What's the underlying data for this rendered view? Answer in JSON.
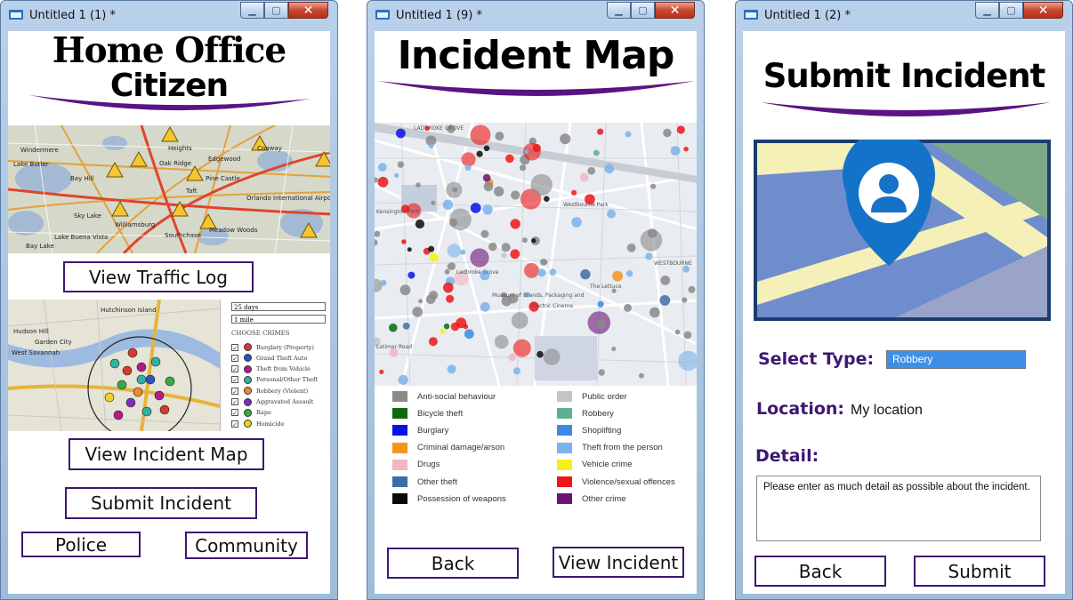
{
  "windows": [
    {
      "title": "Untitled 1 (1) *"
    },
    {
      "title": "Untitled 1 (9) *"
    },
    {
      "title": "Untitled 1 (2) *"
    }
  ],
  "home": {
    "title_line1": "Home Office",
    "title_line2": "Citizen",
    "view_traffic_log": "View Traffic Log",
    "view_incident_map": "View Incident Map",
    "submit_incident": "Submit Incident",
    "police": "Police",
    "community": "Community",
    "traffic_map_labels": [
      "Windermere",
      "Lake Butler",
      "Bay Hill",
      "Sky Lake",
      "Lake Buena Vista",
      "Heights",
      "Edgewood",
      "Pine Castle",
      "Oak Ridge",
      "Taft",
      "Williamsburg",
      "Southchase",
      "Meadow Woods",
      "Bay Lake",
      "Conway",
      "Orlando International Airport"
    ],
    "crime_panel": {
      "period_select": "25 days",
      "distance_select": "1 mile",
      "heading": "CHOOSE CRIMES",
      "items": [
        {
          "label": "Burglary (Property)",
          "color": "#d63a2f"
        },
        {
          "label": "Grand Theft Auto",
          "color": "#2d53c0"
        },
        {
          "label": "Theft from Vehicle",
          "color": "#b31a8c"
        },
        {
          "label": "Personal/Other Theft",
          "color": "#2fb3a3"
        },
        {
          "label": "Robbery (Violent)",
          "color": "#f08a2a"
        },
        {
          "label": "Aggravated Assault",
          "color": "#7d2cc0"
        },
        {
          "label": "Rape",
          "color": "#3aa84a"
        },
        {
          "label": "Homicide",
          "color": "#f2d21f"
        }
      ],
      "map_labels": [
        "Hutchinson Island",
        "Hudson Hill",
        "Garden City",
        "West Savannah"
      ]
    }
  },
  "incident_map": {
    "title": "Incident Map",
    "map_labels": [
      "LADBROKE GROVE",
      "Kensington Park",
      "Westbourne Park",
      "Ladbroke Grove",
      "Museum of Brands, Packaging and",
      "The Lettuce",
      "Electric Cinema",
      "WESTBOURNE",
      "Latimer Road"
    ],
    "legend": [
      {
        "label": "Anti-social behaviour",
        "color": "#8a8a8a"
      },
      {
        "label": "Bicycle theft",
        "color": "#0c6a0c"
      },
      {
        "label": "Burglary",
        "color": "#0a12e6"
      },
      {
        "label": "Criminal damage/arson",
        "color": "#f5951f"
      },
      {
        "label": "Drugs",
        "color": "#f4b6c2"
      },
      {
        "label": "Other theft",
        "color": "#3b6ea8"
      },
      {
        "label": "Possession of weapons",
        "color": "#0a0a0a"
      },
      {
        "label": "Public order",
        "color": "#c4c4c4"
      },
      {
        "label": "Robbery",
        "color": "#5bb28f"
      },
      {
        "label": "Shoplifting",
        "color": "#3a8ae4"
      },
      {
        "label": "Theft from the person",
        "color": "#7ab3ea"
      },
      {
        "label": "Vehicle crime",
        "color": "#f5f01a"
      },
      {
        "label": "Violence/sexual offences",
        "color": "#f01616"
      },
      {
        "label": "Other crime",
        "color": "#6b1476"
      }
    ],
    "back": "Back",
    "view_incident": "View Incident"
  },
  "submit": {
    "title": "Submit Incident",
    "select_type_label": "Select Type:",
    "select_type_value": "Robbery",
    "location_label": "Location:",
    "location_value": "My location",
    "detail_label": "Detail:",
    "detail_text": "Please enter as much detail as possible about the incident.",
    "back": "Back",
    "submit": "Submit"
  },
  "colors": {
    "accent_purple": "#3d1873",
    "swoosh": "#5a1382",
    "select_blue": "#3d8fe6",
    "pin_blue": "#1472c8"
  }
}
